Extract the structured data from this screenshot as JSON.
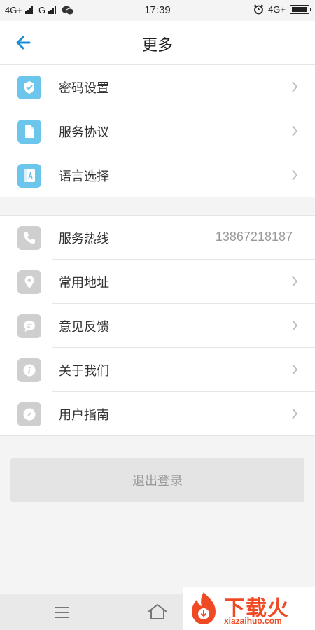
{
  "status_bar": {
    "network_1": "4G+",
    "network_2": "G",
    "time": "17:39",
    "network_3": "4G+",
    "icons": [
      "signal-icon",
      "wechat-icon",
      "alarm-icon",
      "battery-icon"
    ]
  },
  "header": {
    "title": "更多",
    "back_icon": "back-arrow-icon"
  },
  "group1": {
    "items": [
      {
        "label": "密码设置",
        "icon": "shield-icon",
        "color": "#6cc6ec"
      },
      {
        "label": "服务协议",
        "icon": "document-icon",
        "color": "#6cc6ec"
      },
      {
        "label": "语言选择",
        "icon": "language-book-icon",
        "color": "#6cc6ec"
      }
    ]
  },
  "group2": {
    "items": [
      {
        "label": "服务热线",
        "value": "13867218187",
        "icon": "phone-icon"
      },
      {
        "label": "常用地址",
        "icon": "location-icon"
      },
      {
        "label": "意见反馈",
        "icon": "chat-bubble-icon"
      },
      {
        "label": "关于我们",
        "icon": "info-icon"
      },
      {
        "label": "用户指南",
        "icon": "compass-icon"
      }
    ]
  },
  "logout": {
    "label": "退出登录"
  },
  "nav_bar": {
    "icons": [
      "menu-icon",
      "home-icon"
    ]
  },
  "watermark": {
    "text": "下载火",
    "sub": "xiazaihuo.com"
  },
  "colors": {
    "accent": "#1a8bd6",
    "icon_blue": "#6cc6ec",
    "icon_gray": "#cfcfcf",
    "watermark": "#ef4a23"
  }
}
